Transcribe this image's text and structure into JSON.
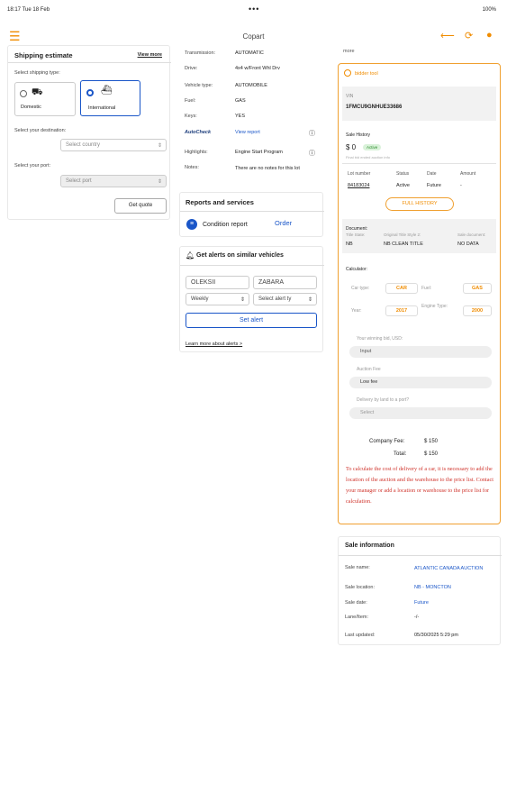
{
  "status": {
    "time": "18:17  Tue 18 Feb",
    "dots": "•••",
    "right": "100%"
  },
  "nav": {
    "title": "Copart"
  },
  "ship": {
    "title": "Shipping estimate",
    "view_more": "View more",
    "type_label": "Select shipping type:",
    "domestic": "Domestic",
    "international": "International",
    "dest_label": "Select your destination:",
    "country_ph": "Select country",
    "port_label": "Select your port:",
    "port_ph": "Select port",
    "quote_btn": "Get quote"
  },
  "vehicle": {
    "rows": [
      {
        "k": "Transmission:",
        "v": "AUTOMATIC"
      },
      {
        "k": "Drive:",
        "v": "4x4 w/Front Whl Drv"
      },
      {
        "k": "Vehicle type:",
        "v": "AUTOMOBILE"
      },
      {
        "k": "Fuel:",
        "v": "GAS"
      },
      {
        "k": "Keys:",
        "v": "YES"
      }
    ],
    "autocheck": "AutoCheck",
    "view_report": "View report",
    "highlights_k": "Highlights:",
    "highlights_v": "Engine Start Program",
    "notes_k": "Notes:",
    "notes_v": "There are no notes for this lot"
  },
  "reports": {
    "title": "Reports and services",
    "condition": "Condition report",
    "order": "Order"
  },
  "alerts": {
    "title": "Get alerts on similar vehicles",
    "first": "OLEKSII",
    "last": "ZABARA",
    "freq": "Weekly",
    "alert_type": "Select alert ty",
    "set_btn": "Set alert",
    "learn": "Learn more about alerts >"
  },
  "bid": {
    "top_label": "more",
    "logo": "bidder tool",
    "vin_label": "VIN",
    "vin": "1FMCU9GNHUE33686",
    "sale_history": "Sale History",
    "price": "$ 0",
    "badge": "Active",
    "final_note": "Final bid ended auction info",
    "lot_h": "Lot number",
    "status_h": "Status",
    "date_h": "Date",
    "amount_h": "Amount",
    "lot": "84183024",
    "status": "Active",
    "date": "Future",
    "amount": "-",
    "full_history": "FULL HISTORY",
    "doc_label": "Document:",
    "doc_h1": "Title State:",
    "doc_h2": "Original Title Style 2:",
    "doc_h3": "Sale document:",
    "doc_v1": "NB",
    "doc_v2": "NB CLEAN TITLE",
    "doc_v3": "NO DATA",
    "calc_label": "Calculator:",
    "car_type_k": "Car type:",
    "car_type": "CAR",
    "fuel_k": "Fuel:",
    "fuel": "GAS",
    "year_k": "Year:",
    "year": "2017",
    "engine_k": "Engine Type:",
    "engine": "2000",
    "winning_bid": "Your winning bid, USD:",
    "input": "Input",
    "auction_fee": "Auction Fee",
    "low_fee": "Low fee",
    "delivery": "Delivery by land to a port?",
    "select": "Select",
    "company_fee_k": "Company Fee:",
    "company_fee": "$ 150",
    "total_k": "Total:",
    "total": "$ 150",
    "warning": "To calculate the cost of delivery of a car, it is necessary to add the location of the auction and the warehouse to the price list. Contact your manager or add a location or warehouse to the price list for calculation."
  },
  "sale": {
    "title": "Sale information",
    "rows": [
      {
        "k": "Sale name:",
        "v": "ATLANTIC CANADA AUCTION"
      },
      {
        "k": "Sale location:",
        "v": "NB - MONCTON"
      },
      {
        "k": "Sale date:",
        "v": "Future"
      },
      {
        "k": "Lane/Item:",
        "v": "-/-"
      },
      {
        "k": "Last updated:",
        "v": "05/30/2025 5:29 pm"
      }
    ]
  },
  "colors": {
    "accent": "#f08c00",
    "link": "#1a56c8",
    "warning": "#d0342c"
  }
}
